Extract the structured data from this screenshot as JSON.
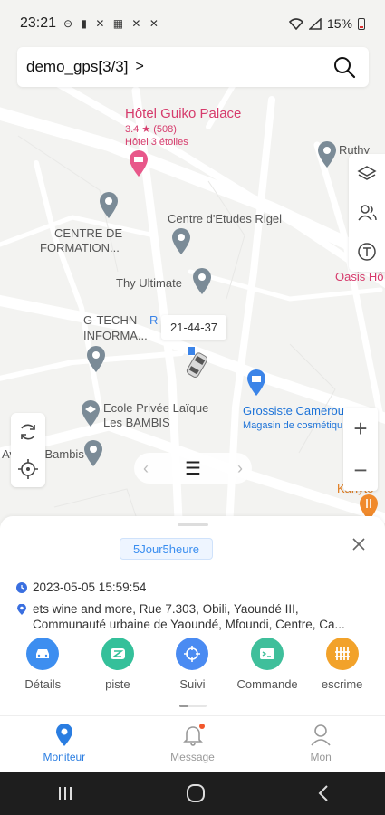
{
  "status_bar": {
    "time": "23:21",
    "notification_icons": "⊝ ▮ ✕ ▦ ✕ ✕",
    "battery_text": "15%"
  },
  "search": {
    "device_name": "demo_gps[3/3]",
    "chevron": ">"
  },
  "map": {
    "places": {
      "hotel_title": "Hôtel Guiko Palace",
      "hotel_rating": "3.4 ★ (508)",
      "hotel_type": "Hôtel 3 étoiles",
      "ruthy": "Ruthy",
      "centre_formation_1": "CENTRE DE",
      "centre_formation_2": "FORMATION...",
      "centre_rigel": "Centre d'Etudes Rigel",
      "oasis": "Oasis Hô",
      "thy_ultimate": "Thy Ultimate",
      "gtech_1": "G-TECHN",
      "gtech_2": "INFORMA...",
      "gtech_r": "R",
      "ecole_1": "Ecole Privée Laïque",
      "ecole_2": "Les BAMBIS",
      "grossiste_title": "Grossiste Camerou",
      "grossiste_sub": "Magasin de cosmétiqu",
      "avenue_bambis": "Avenue Bambis",
      "kahyto": "Kahyto"
    },
    "vehicle_plate": "21-44-37",
    "zoom_in": "+",
    "zoom_out": "−"
  },
  "sheet": {
    "duration_pill": "5Jour5heure",
    "datetime": "2023-05-05 15:59:54",
    "address": "ets wine and more, Rue 7.303, Obili, Yaoundé III, Communauté urbaine de Yaoundé, Mfoundi, Centre, Ca...",
    "actions": [
      {
        "label": "Détails",
        "color": "#3d8ef0",
        "icon": "car-icon"
      },
      {
        "label": "piste",
        "color": "#34c09a",
        "icon": "track-icon"
      },
      {
        "label": "Suivi",
        "color": "#4a8bf2",
        "icon": "crosshair-icon"
      },
      {
        "label": "Commande",
        "color": "#3fbf9b",
        "icon": "terminal-icon"
      },
      {
        "label": "escrime",
        "color": "#f2a22a",
        "icon": "fence-icon"
      }
    ]
  },
  "tabbar": {
    "tabs": [
      {
        "label": "Moniteur",
        "icon": "location-pin-icon",
        "active": true
      },
      {
        "label": "Message",
        "icon": "bell-icon",
        "active": false
      },
      {
        "label": "Mon",
        "icon": "person-icon",
        "active": false
      }
    ]
  },
  "colors": {
    "accent": "#2a7de1",
    "poi_red": "#d63b6c",
    "poi_blue": "#1d73d8"
  }
}
